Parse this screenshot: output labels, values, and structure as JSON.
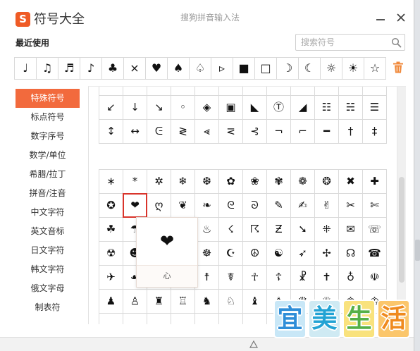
{
  "window": {
    "title": "符号大全",
    "subtitle": "搜狗拼音输入法",
    "logo_letter": "S"
  },
  "recent": {
    "label": "最近使用",
    "items": [
      "♩",
      "♫",
      "♬",
      "♪",
      "♣",
      "×",
      "♥",
      "♠",
      "♤",
      "▹",
      "■",
      "□",
      "☽",
      "☾",
      "☼",
      "☀",
      "☆"
    ]
  },
  "search": {
    "placeholder": "搜索符号"
  },
  "sidebar": {
    "selected_index": 0,
    "items": [
      "特殊符号",
      "标点符号",
      "数字序号",
      "数学/单位",
      "希腊/拉丁",
      "拼音/注音",
      "中文字符",
      "英文音标",
      "日文字符",
      "韩文字符",
      "俄文字母",
      "制表符"
    ]
  },
  "grid": {
    "upper_block": [
      [
        "",
        "",
        "",
        "",
        "",
        "",
        "",
        "",
        "",
        "",
        "",
        ""
      ],
      [
        "↙",
        "↓",
        "↘",
        "◦",
        "◈",
        "▣",
        "◣",
        "Ⓣ",
        "◢",
        "☷",
        "☵",
        "☰"
      ],
      [
        "↕",
        "↔",
        "ᕮ",
        "≷",
        "⪡",
        "⋜",
        "⊰",
        "¬",
        "⌐",
        "━",
        "†",
        "‡"
      ]
    ],
    "lower_block": [
      [
        "∗",
        "*",
        "✲",
        "❄",
        "❆",
        "✿",
        "❀",
        "✾",
        "❁",
        "❂",
        "✖",
        "✚"
      ],
      [
        "✪",
        "❤",
        "ღ",
        "❦",
        "❧",
        "ᘓ",
        "ᘐ",
        "✎",
        "✍",
        "✌",
        "✂",
        "✄"
      ],
      [
        "☘",
        "☂",
        "",
        "",
        "♨",
        "☇",
        "☈",
        "Ƶ",
        "➘",
        "⁜",
        "✉",
        "☏"
      ],
      [
        "☢",
        "☻",
        "",
        "",
        "☸",
        "☪",
        "☮",
        "☯",
        "➶",
        "✢",
        "☊",
        "☎"
      ],
      [
        "✈",
        "☙",
        "",
        "",
        "☨",
        "☤",
        "☥",
        "☦",
        "☧",
        "✝",
        "♁",
        "☫"
      ],
      [
        "♟",
        "♙",
        "♜",
        "♖",
        "♞",
        "♘",
        "♝",
        "♗",
        "♛",
        "♕",
        "♚",
        "♔"
      ],
      [
        "",
        "",
        "",
        "",
        "",
        "",
        "",
        "",
        "",
        "",
        "",
        ""
      ]
    ],
    "selected": {
      "block": "lower_block",
      "row": 1,
      "col": 1
    }
  },
  "preview": {
    "symbol": "❤",
    "name": "心"
  },
  "watermark": {
    "chars": [
      "宜",
      "美",
      "生",
      "活"
    ]
  },
  "icons": {
    "minimize": "minimize-icon",
    "close": "close-icon",
    "search": "search-icon",
    "clear_recent": "trash-icon"
  },
  "colors": {
    "accent": "#f26a3d",
    "selected_border": "#d9342b",
    "logo": "#ef5b25",
    "trash": "#f08a3c"
  }
}
